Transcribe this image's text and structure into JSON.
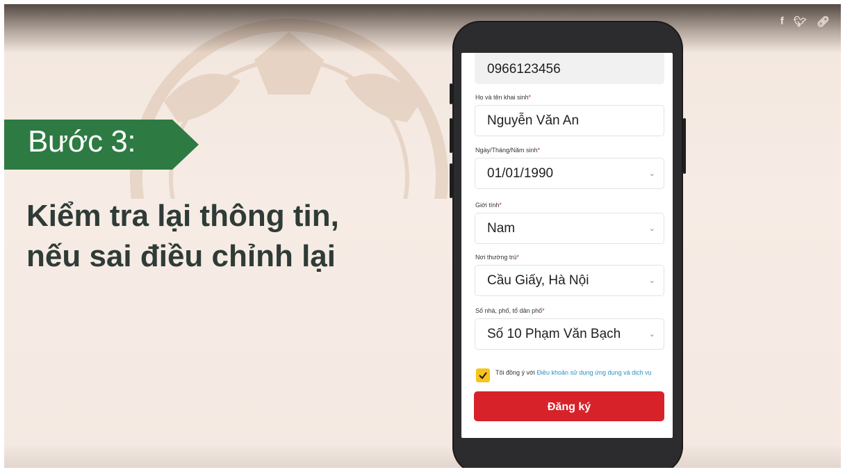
{
  "slide": {
    "step_label": "Bước 3:",
    "heading_line1": "Kiểm tra lại thông tin,",
    "heading_line2": "nếu sai điều chỉnh lại",
    "share_icons": [
      "facebook-icon",
      "twitter-icon",
      "link-icon"
    ],
    "colors": {
      "banner": "#2e7a43",
      "heading": "#2f3b37",
      "background": "#f4e9e2"
    }
  },
  "form": {
    "phone_value": "0966123456",
    "fullname": {
      "label": "Họ và tên khai sinh",
      "value": "Nguyễn Văn An"
    },
    "birthdate": {
      "label": "Ngày/Tháng/Năm sinh",
      "value": "01/01/1990"
    },
    "gender": {
      "label": "Giới tính",
      "value": "Nam"
    },
    "residence": {
      "label": "Nơi thường trú",
      "value": "Cầu Giấy, Hà Nội"
    },
    "address": {
      "label": "Số nhà, phố, tổ dân phố",
      "value": "Số 10 Phạm Văn Bạch"
    },
    "required_mark": "*",
    "agree": {
      "checked": true,
      "text": "Tôi đồng ý với ",
      "link": "Điều khoản sử dụng ứng dụng và dịch vụ"
    },
    "submit_label": "Đăng ký",
    "colors": {
      "submit": "#d82229",
      "checkbox": "#f7c41d",
      "link": "#2b8fc7"
    }
  }
}
